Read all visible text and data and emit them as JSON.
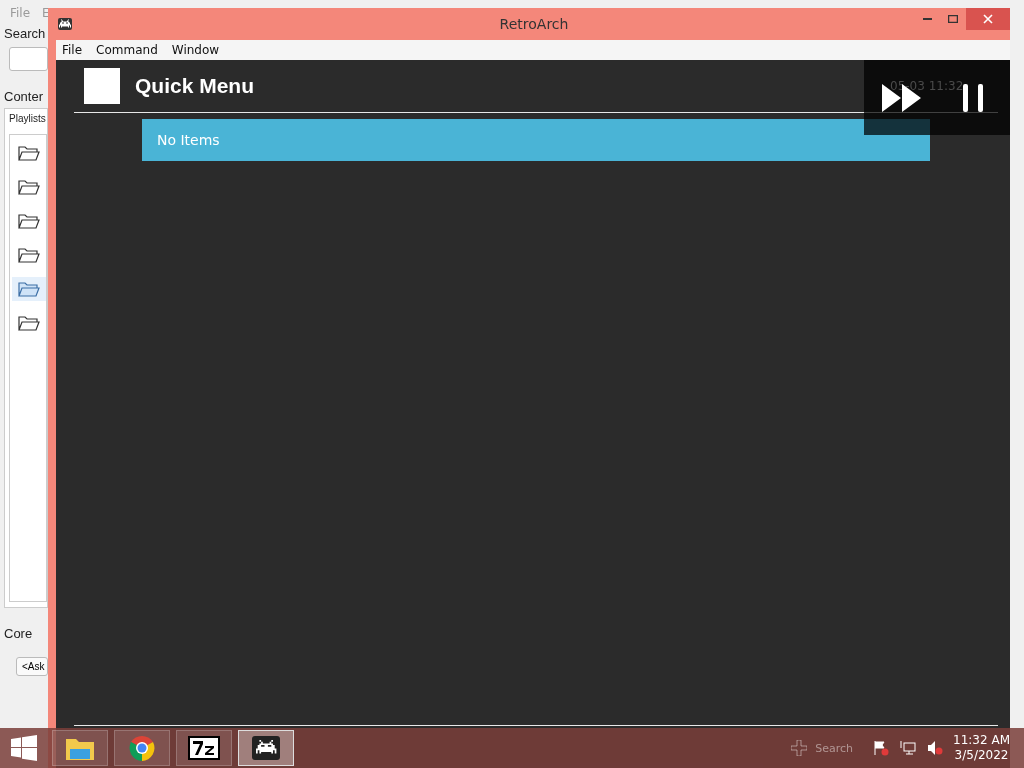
{
  "background_window": {
    "menu": [
      "File",
      "E"
    ],
    "search_label": "Search",
    "content_label": "Conter",
    "tab": "Playlists",
    "playlists": [
      {
        "selected": false
      },
      {
        "selected": false
      },
      {
        "selected": false
      },
      {
        "selected": false
      },
      {
        "selected": true
      },
      {
        "selected": false
      }
    ],
    "core_label": "Core",
    "core_button": "<Ask"
  },
  "window": {
    "title": "RetroArch",
    "menu": [
      "File",
      "Command",
      "Window"
    ],
    "header": {
      "title": "Quick Menu",
      "clock": "05-03 11:32"
    },
    "items": [
      {
        "label": "No Items",
        "selected": true
      }
    ],
    "footer_hints": [
      {
        "kind": "search",
        "label": "Search"
      }
    ]
  },
  "taskbar": {
    "apps": [
      {
        "kind": "explorer",
        "selected": false
      },
      {
        "kind": "chrome",
        "selected": false
      },
      {
        "kind": "sevenzip",
        "selected": false
      },
      {
        "kind": "retroarch",
        "selected": true
      }
    ],
    "time": "11:32 AM",
    "date": "3/5/2022"
  }
}
